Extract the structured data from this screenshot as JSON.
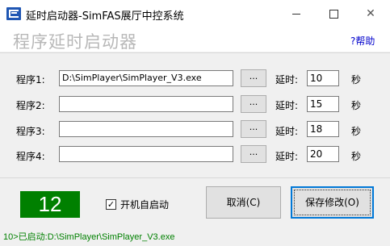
{
  "window": {
    "title": "延时启动器-SimFAS展厅中控系统",
    "min_glyph": "",
    "max_glyph": "",
    "close_glyph": "✕"
  },
  "header": {
    "title": "程序延时启动器",
    "help": "?帮助"
  },
  "programs": [
    {
      "label": "程序1:",
      "path": "D:\\SimPlayer\\SimPlayer_V3.exe",
      "browse": "...",
      "delay_label": "延时:",
      "delay": "10",
      "unit": "秒"
    },
    {
      "label": "程序2:",
      "path": "",
      "browse": "...",
      "delay_label": "延时:",
      "delay": "15",
      "unit": "秒"
    },
    {
      "label": "程序3:",
      "path": "",
      "browse": "...",
      "delay_label": "延时:",
      "delay": "18",
      "unit": "秒"
    },
    {
      "label": "程序4:",
      "path": "",
      "browse": "...",
      "delay_label": "延时:",
      "delay": "20",
      "unit": "秒"
    }
  ],
  "footer": {
    "countdown": "12",
    "autostart_checked": true,
    "autostart_check": "✓",
    "autostart_label": "开机自启动",
    "cancel": "取消(C)",
    "save": "保存修改(O)",
    "status": "10>已启动:D:\\SimPlayer\\SimPlayer_V3.exe"
  },
  "colors": {
    "counter_bg": "#008000",
    "status_text": "#008000",
    "help_link": "#0000cc",
    "title_faded": "#b8b8b8",
    "focus_border": "#0078d7"
  }
}
